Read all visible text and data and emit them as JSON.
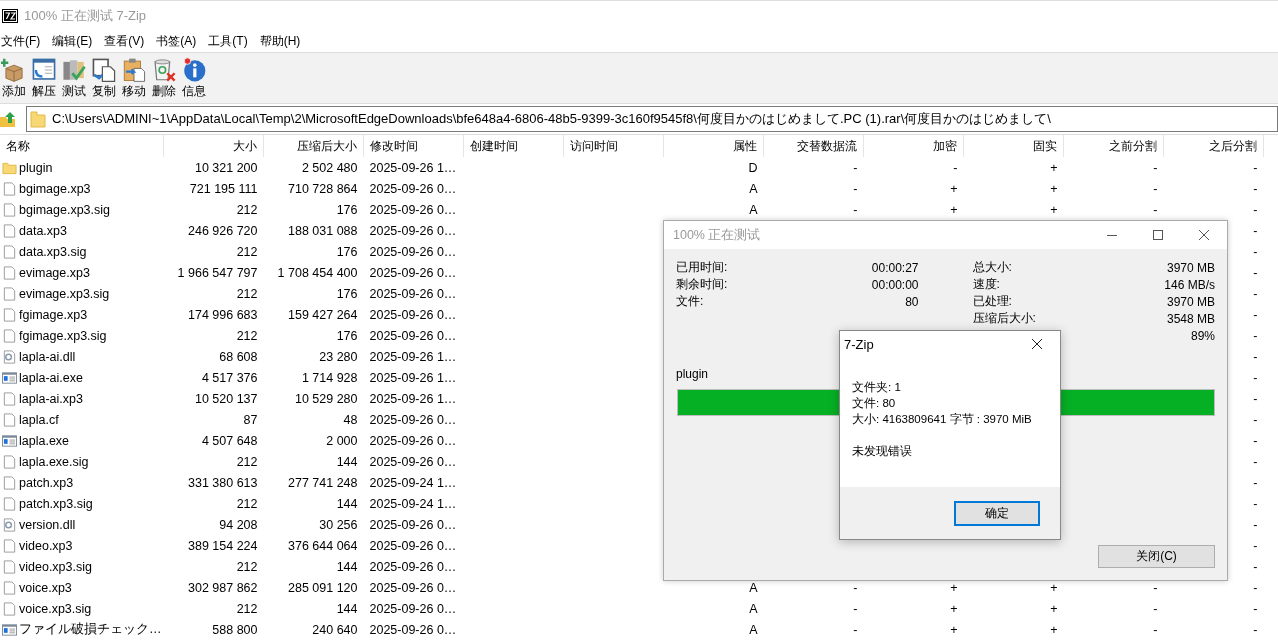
{
  "window": {
    "title": "100% 正在测试 7-Zip"
  },
  "menu": [
    "文件(F)",
    "编辑(E)",
    "查看(V)",
    "书签(A)",
    "工具(T)",
    "帮助(H)"
  ],
  "toolbar": [
    {
      "kind": "add",
      "label": "添加"
    },
    {
      "kind": "extract",
      "label": "解压"
    },
    {
      "kind": "test",
      "label": "测试"
    },
    {
      "kind": "copy",
      "label": "复制"
    },
    {
      "kind": "move",
      "label": "移动"
    },
    {
      "kind": "delete",
      "label": "删除"
    },
    {
      "kind": "info",
      "label": "信息"
    }
  ],
  "address": {
    "value": "C:\\Users\\ADMINI~1\\AppData\\Local\\Temp\\2\\MicrosoftEdgeDownloads\\bfe648a4-6806-48b5-9399-3c160f9545f8\\何度目かのはじめまして.PC (1).rar\\何度目かのはじめまして\\"
  },
  "table": {
    "columns": [
      "名称",
      "大小",
      "压缩后大小",
      "修改时间",
      "创建时间",
      "访问时间",
      "属性",
      "交替数据流",
      "加密",
      "固实",
      "之前分割",
      "之后分割"
    ],
    "rows": [
      {
        "kind": "folder",
        "name": "plugin",
        "size": "10 321 200",
        "packed": "2 502 480",
        "modified": "2025-09-26 1…",
        "attr": "D",
        "alt_stream": "-",
        "encrypted": "-",
        "solid": "+",
        "split_before": "-",
        "split_after": "-"
      },
      {
        "kind": "file",
        "name": "bgimage.xp3",
        "size": "721 195 111",
        "packed": "710 728 864",
        "modified": "2025-09-26 0…",
        "attr": "A",
        "alt_stream": "-",
        "encrypted": "+",
        "solid": "+",
        "split_before": "-",
        "split_after": "-"
      },
      {
        "kind": "file",
        "name": "bgimage.xp3.sig",
        "size": "212",
        "packed": "176",
        "modified": "2025-09-26 0…",
        "attr": "A",
        "alt_stream": "-",
        "encrypted": "+",
        "solid": "+",
        "split_before": "-",
        "split_after": "-"
      },
      {
        "kind": "file",
        "name": "data.xp3",
        "size": "246 926 720",
        "packed": "188 031 088",
        "modified": "2025-09-26 0…",
        "split_after": "-"
      },
      {
        "kind": "file",
        "name": "data.xp3.sig",
        "size": "212",
        "packed": "176",
        "modified": "2025-09-26 0…",
        "split_after": "-"
      },
      {
        "kind": "file",
        "name": "evimage.xp3",
        "size": "1 966 547 797",
        "packed": "1 708 454 400",
        "modified": "2025-09-26 0…",
        "split_after": "-"
      },
      {
        "kind": "file",
        "name": "evimage.xp3.sig",
        "size": "212",
        "packed": "176",
        "modified": "2025-09-26 0…",
        "split_after": "-"
      },
      {
        "kind": "file",
        "name": "fgimage.xp3",
        "size": "174 996 683",
        "packed": "159 427 264",
        "modified": "2025-09-26 0…",
        "split_after": "-"
      },
      {
        "kind": "file",
        "name": "fgimage.xp3.sig",
        "size": "212",
        "packed": "176",
        "modified": "2025-09-26 0…",
        "split_after": "-"
      },
      {
        "kind": "dll",
        "name": "lapla-ai.dll",
        "size": "68 608",
        "packed": "23 280",
        "modified": "2025-09-26 1…",
        "split_after": "-"
      },
      {
        "kind": "exe",
        "name": "lapla-ai.exe",
        "size": "4 517 376",
        "packed": "1 714 928",
        "modified": "2025-09-26 1…",
        "split_after": "-"
      },
      {
        "kind": "file",
        "name": "lapla-ai.xp3",
        "size": "10 520 137",
        "packed": "10 529 280",
        "modified": "2025-09-26 1…",
        "split_after": "-"
      },
      {
        "kind": "file",
        "name": "lapla.cf",
        "size": "87",
        "packed": "48",
        "modified": "2025-09-26 0…",
        "split_after": "-"
      },
      {
        "kind": "exe",
        "name": "lapla.exe",
        "size": "4 507 648",
        "packed": "2 000",
        "modified": "2025-09-26 0…",
        "split_after": "-"
      },
      {
        "kind": "file",
        "name": "lapla.exe.sig",
        "size": "212",
        "packed": "144",
        "modified": "2025-09-26 0…",
        "split_after": "-"
      },
      {
        "kind": "file",
        "name": "patch.xp3",
        "size": "331 380 613",
        "packed": "277 741 248",
        "modified": "2025-09-24 1…",
        "split_after": "-"
      },
      {
        "kind": "file",
        "name": "patch.xp3.sig",
        "size": "212",
        "packed": "144",
        "modified": "2025-09-24 1…",
        "split_after": "-"
      },
      {
        "kind": "dll",
        "name": "version.dll",
        "size": "94 208",
        "packed": "30 256",
        "modified": "2025-09-26 0…",
        "split_after": "-"
      },
      {
        "kind": "file",
        "name": "video.xp3",
        "size": "389 154 224",
        "packed": "376 644 064",
        "modified": "2025-09-26 0…",
        "split_after": "-"
      },
      {
        "kind": "file",
        "name": "video.xp3.sig",
        "size": "212",
        "packed": "144",
        "modified": "2025-09-26 0…",
        "split_after": "-"
      },
      {
        "kind": "file",
        "name": "voice.xp3",
        "size": "302 987 862",
        "packed": "285 091 120",
        "modified": "2025-09-26 0…",
        "attr": "A",
        "alt_stream": "-",
        "encrypted": "+",
        "solid": "+",
        "split_before": "-",
        "split_after": "-"
      },
      {
        "kind": "file",
        "name": "voice.xp3.sig",
        "size": "212",
        "packed": "144",
        "modified": "2025-09-26 0…",
        "attr": "A",
        "alt_stream": "-",
        "encrypted": "+",
        "solid": "+",
        "split_before": "-",
        "split_after": "-"
      },
      {
        "kind": "exe",
        "name": "ファイル破損チェック…",
        "size": "588 800",
        "packed": "240 640",
        "modified": "2025-09-26 0…",
        "attr": "A",
        "alt_stream": "-",
        "encrypted": "+",
        "solid": "+",
        "split_before": "-",
        "split_after": "-"
      }
    ]
  },
  "progress_dialog": {
    "title": "100% 正在测试",
    "left_stats": [
      {
        "label": "已用时间:",
        "value": "00:00:27"
      },
      {
        "label": "剩余时间:",
        "value": "00:00:00"
      },
      {
        "label": "文件:",
        "value": "80"
      }
    ],
    "right_stats": [
      {
        "label": "总大小:",
        "value": "3970 MB"
      },
      {
        "label": "速度:",
        "value": "146 MB/s"
      },
      {
        "label": "已处理:",
        "value": "3970 MB"
      },
      {
        "label": "压缩后大小:",
        "value": "3548 MB"
      },
      {
        "value": "89%"
      }
    ],
    "current_item": "plugin",
    "level": 1,
    "close_button": "关闭(C)"
  },
  "message_box": {
    "title": "7-Zip",
    "lines": [
      "文件夹: 1",
      "文件: 80",
      "大小: 4163809641 字节 : 3970 MiB"
    ],
    "result": "未发现错误",
    "ok_button": "确定"
  }
}
